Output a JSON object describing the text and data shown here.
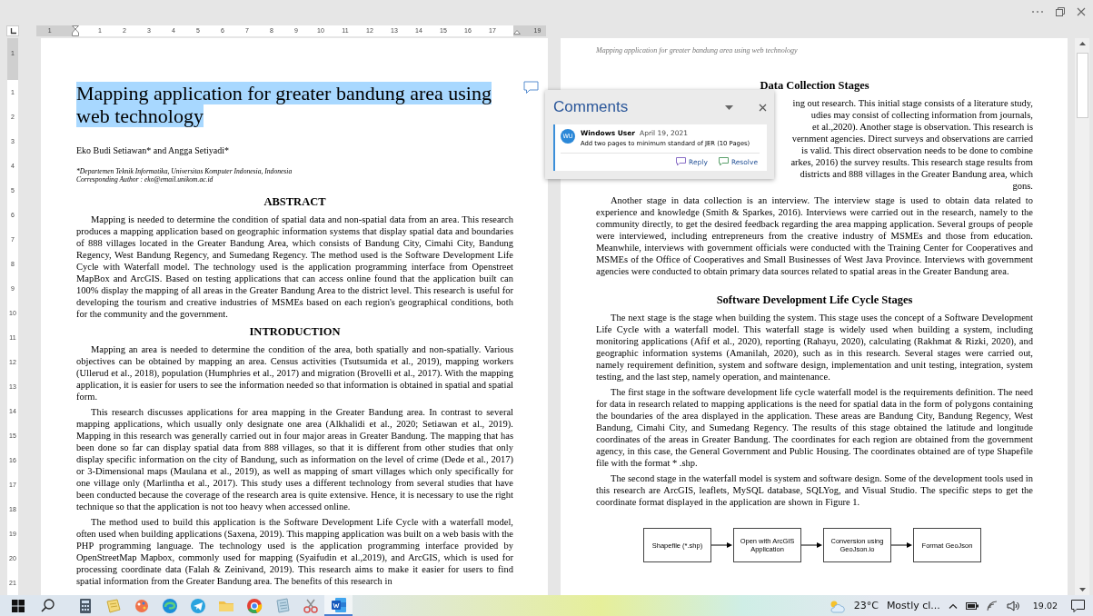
{
  "ruler": {
    "horizontal": [
      "1",
      "1",
      "2",
      "3",
      "4",
      "5",
      "6",
      "7",
      "8",
      "9",
      "10",
      "11",
      "12",
      "13",
      "14",
      "15",
      "16",
      "17",
      "19"
    ],
    "vertical": [
      "1",
      "1",
      "2",
      "3",
      "4",
      "5",
      "6",
      "7",
      "8",
      "9",
      "10",
      "11",
      "12",
      "13",
      "14",
      "15",
      "16",
      "17",
      "18",
      "19",
      "20",
      "21"
    ]
  },
  "left_page": {
    "title": {
      "text": "Mapping application for greater bandung area using web technology",
      "selected": true
    },
    "authors": "Eko Budi Setiawan* and Angga Setiyadi*",
    "affiliation": [
      "*Departemen Teknik Informatika, Universitas Komputer Indonesia, Indonesia",
      "Corresponding Author : eko@email.unikom.ac.id"
    ],
    "sections": [
      {
        "heading": "ABSTRACT",
        "paragraphs": [
          "Mapping is needed to determine the condition of spatial data and non-spatial data from an area. This research produces a mapping application based on geographic information systems that display spatial data and boundaries of 888 villages located in the Greater Bandung Area, which consists of Bandung City, Cimahi City, Bandung Regency, West Bandung Regency, and Sumedang Regency. The method used is the Software Development Life Cycle with Waterfall model. The technology used is the application programming interface from Openstreet MapBox and ArcGIS. Based on testing applications that can access online found that the application built can 100% display the mapping of all areas in the Greater Bandung Area to the district level. This research is useful for developing the tourism and creative industries of MSMEs based on each region's geographical conditions, both for the community and the government."
        ]
      },
      {
        "heading": "INTRODUCTION",
        "paragraphs": [
          "Mapping an area is needed to determine the condition of the area, both spatially and non-spatially. Various objectives can be obtained by mapping an area. Census activities (Tsutsumida et al., 2019), mapping workers (Ullerud et al., 2018), population (Humphries et al., 2017) and migration (Brovelli et al., 2017). With the mapping application, it is easier for users to see the information needed so that information is obtained in spatial and spatial form.",
          "This research discusses applications for area mapping in the Greater Bandung area. In contrast to several mapping applications, which usually only designate one area (Alkhalidi et al., 2020; Setiawan et al., 2019). Mapping in this research was generally carried out in four major areas in Greater Bandung. The mapping that has been done so far can display spatial data from 888 villages, so that it is different from other studies that only display specific information on the city of Bandung, such as information on the level of crime (Dede et al., 2017) or 3-Dimensional maps (Maulana et al., 2019), as well as mapping of smart villages which only specifically for one village only (Marlintha et al., 2017). This study uses a different technology from several studies that have been conducted because the coverage of the research area is quite extensive. Hence, it is necessary to use the right technique so that the application is not too heavy when accessed online.",
          "The method used to build this application is the Software Development Life Cycle with a waterfall model, often used when building applications (Saxena, 2019). This mapping application was built on a web basis with the PHP programming language. The technology used is the application programming interface provided by OpenStreetMap Mapbox, commonly used for mapping (Syaifudin et al.,2019), and ArcGIS, which is used for processing coordinate data (Falah & Zeinivand, 2019). This research aims to make it easier for users to find spatial information from the Greater Bandung area. The benefits of this research in"
        ]
      }
    ]
  },
  "right_page": {
    "header": "Mapping application for greater bandung area using web technology",
    "sections": [
      {
        "heading": "Data Collection Stages",
        "fragment_lines": [
          "ing out research. This initial stage consists of a literature study,",
          "udies may consist of collecting information from journals,",
          "et al.,2020). Another stage is observation. This research is",
          "vernment agencies. Direct surveys and observations are carried",
          "is valid. This direct observation needs to be done to combine",
          "arkes, 2016) the survey results. This research stage results from",
          "districts and 888 villages in the Greater Bandung area, which",
          "gons."
        ],
        "paragraphs": [
          "Another stage in data collection is an interview. The interview stage is used to obtain data related to experience and knowledge (Smith & Sparkes, 2016). Interviews were carried out in the research, namely to the community directly, to get the desired feedback regarding the area mapping application. Several groups of people were interviewed, including entrepreneurs from the creative industry of MSMEs and those from education. Meanwhile, interviews with government officials were conducted with the Training Center for Cooperatives and MSMEs of the Office of Cooperatives and Small Businesses of West Java Province. Interviews with government agencies were conducted to obtain primary data sources related to spatial areas in the Greater Bandung area."
        ]
      },
      {
        "heading": "Software Development Life Cycle Stages",
        "paragraphs": [
          "The next stage is the stage when building the system. This stage uses the concept of a Software Development Life Cycle with a waterfall model. This waterfall stage is widely used when building a system, including monitoring applications (Afif et al., 2020), reporting (Rahayu, 2020), calculating (Rakhmat & Rizki, 2020), and geographic information systems (Amanilah, 2020), such as in this research. Several stages were carried out, namely requirement definition, system and software design, implementation and unit testing, integration, system testing, and the last step, namely operation, and maintenance.",
          "The first stage in the software development life cycle waterfall model is the requirements definition. The need for data in research related to mapping applications is the need for spatial data in the form of polygons containing the boundaries of the area displayed in the application. These areas are Bandung City, Bandung Regency, West Bandung, Cimahi City, and Sumedang Regency. The results of this stage obtained the latitude and longitude coordinates of the areas in Greater Bandung. The coordinates for each region are obtained from the government agency, in this case, the General Government and Public Housing. The coordinates obtained are of type Shapefile file with the format * .shp.",
          "The second stage in the waterfall model is system and software design. Some of the development tools used in this research are ArcGIS, leaflets, MySQL database, SQLYog, and Visual Studio. The specific steps to get the coordinate format displayed in the application are shown in Figure 1."
        ]
      }
    ],
    "flowchart": [
      "Shapefile (*.shp)",
      "Open with ArcGIS Application",
      "Conversion using GeoJson.io",
      "Format GeoJson"
    ]
  },
  "comments_pane": {
    "title": "Comments",
    "comments": [
      {
        "initials": "WU",
        "author": "Windows User",
        "date": "April 19, 2021",
        "text": "Add two pages to minimum standard of JER (10 Pages)",
        "actions": [
          "Reply",
          "Resolve"
        ]
      }
    ]
  },
  "taskbar": {
    "apps": [
      {
        "kind": "calculator",
        "selected": false
      },
      {
        "kind": "notes",
        "selected": false
      },
      {
        "kind": "paint",
        "selected": false
      },
      {
        "kind": "edge",
        "selected": false
      },
      {
        "kind": "telegram",
        "selected": false
      },
      {
        "kind": "folder",
        "selected": false
      },
      {
        "kind": "chrome",
        "selected": false
      },
      {
        "kind": "notepad",
        "selected": false
      },
      {
        "kind": "snip",
        "selected": false
      },
      {
        "kind": "word",
        "selected": true
      }
    ],
    "weather": {
      "temperature": "23°C",
      "summary": "Mostly cl..."
    },
    "time": "19.02"
  }
}
